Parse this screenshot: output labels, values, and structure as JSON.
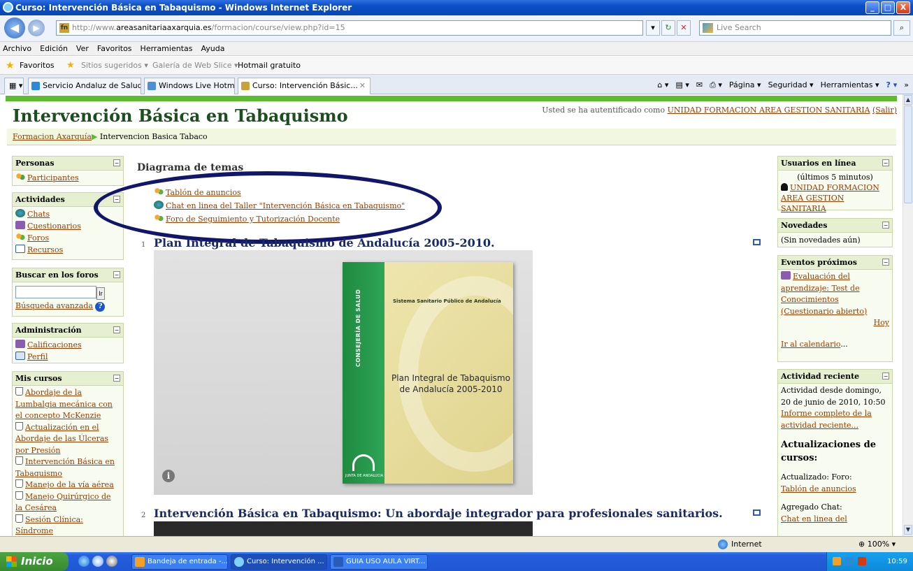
{
  "window": {
    "title": "Curso: Intervención Básica en Tabaquismo - Windows Internet Explorer",
    "min": "_",
    "max": "□",
    "close": "X"
  },
  "address": {
    "url_pre": "http://www.",
    "url_host": "areasanitariaaxarquia.es",
    "url_path": "/formacion/course/view.php?id=15",
    "search_placeholder": "Live Search",
    "search_icon": "magnifier-icon"
  },
  "menu": [
    "Archivo",
    "Edición",
    "Ver",
    "Favoritos",
    "Herramientas",
    "Ayuda"
  ],
  "favbar": {
    "favorites": "Favoritos",
    "suggested": "Sitios sugeridos ▾",
    "webslice": "Galería de Web Slice ▾",
    "hotmail": "Hotmail gratuito"
  },
  "tabs": [
    {
      "label": "Servicio Andaluz de Salud"
    },
    {
      "label": "Windows Live Hotmail"
    },
    {
      "label": "Curso: Intervención Básic..."
    }
  ],
  "cmdbar": {
    "pagina": "Página ▾",
    "seguridad": "Seguridad ▾",
    "herramientas": "Herramientas ▾"
  },
  "page": {
    "title": "Intervención Básica en Tabaquismo",
    "login_prefix": "Usted se ha autentificado como ",
    "login_user": "UNIDAD FORMACION AREA GESTION SANITARIA",
    "logout": "(Salir)",
    "breadcrumb_root": "Formacion Axarquía",
    "breadcrumb_sep": "▶",
    "breadcrumb_current": "Intervencion Basica Tabaco"
  },
  "left": {
    "personas": {
      "title": "Personas",
      "participantes": "Participantes"
    },
    "actividades": {
      "title": "Actividades",
      "items": [
        "Chats",
        "Cuestionarios",
        "Foros",
        "Recursos"
      ]
    },
    "buscar": {
      "title": "Buscar en los foros",
      "go": "Ir",
      "advanced": "Búsqueda avanzada",
      "help": "?"
    },
    "admin": {
      "title": "Administración",
      "items": [
        "Calificaciones",
        "Perfil"
      ]
    },
    "cursos": {
      "title": "Mis cursos",
      "items": [
        "Abordaje de la Lumbalgia mecánica con el concepto McKenzie",
        "Actualización en el Abordaje de las Úlceras por Presión",
        "Intervención Básica en Tabaquismo",
        "Manejo de la vía aérea",
        "Manejo Quirúrgico de la Cesárea",
        "Sesión Clínica: Síndrome"
      ]
    }
  },
  "center": {
    "header": "Diagrama de temas",
    "links": [
      "Tablón de anuncios",
      "Chat en linea del Taller \"Intervención Básica en Tabaquismo\"",
      "Foro de Seguimiento y Tutorización Docente"
    ],
    "sections": [
      {
        "num": "1",
        "title": "Plan Integral de Tabaquismo de Andalucía 2005-2010."
      },
      {
        "num": "2",
        "title": "Intervención Básica en Tabaquismo: Un abordaje integrador para profesionales sanitarios."
      }
    ],
    "book": {
      "spine": "CONSEJERÍA DE SALUD",
      "publisher": "Sistema Sanitario Público de Andalucía",
      "title": "Plan Integral de Tabaquismo de Andalucía 2005-2010",
      "emblem": "JUNTA DE ANDALUCIA"
    },
    "info": "i"
  },
  "right": {
    "online": {
      "title": "Usuarios en línea",
      "subtitle": "(últimos 5 minutos)",
      "user": "UNIDAD FORMACION AREA GESTION SANITARIA"
    },
    "novedades": {
      "title": "Novedades",
      "text": "(Sin novedades aún)"
    },
    "eventos": {
      "title": "Eventos próximos",
      "event": "Evaluación del aprendizaje: Test de Conocimientos (Cuestionario abierto)",
      "hoy": "Hoy",
      "calendar": "Ir al calendario",
      "ellipsis": "..."
    },
    "reciente": {
      "title": "Actividad reciente",
      "since": "Actividad desde domingo, 20 de junio de 2010, 10:50",
      "report": "Informe completo de la actividad reciente...",
      "updates_title": "Actualizaciones de cursos:",
      "updated": "Actualizado: Foro:",
      "updated_link": "Tablón de anuncios",
      "added": "Agregado Chat:",
      "added_link": "Chat en linea del"
    }
  },
  "status": {
    "zone": "Internet",
    "zoom": "100%"
  },
  "taskbar": {
    "start": "Inicio",
    "items": [
      "Bandeja de entrada -...",
      "Curso: Intervención ...",
      "GUIA USO AULA VIRT..."
    ],
    "clock": "10:59"
  },
  "colors": {
    "accent_green": "#5dbb2f",
    "title_green": "#1c4e1f",
    "link": "#9a3b00",
    "ellipse": "#12166b"
  }
}
